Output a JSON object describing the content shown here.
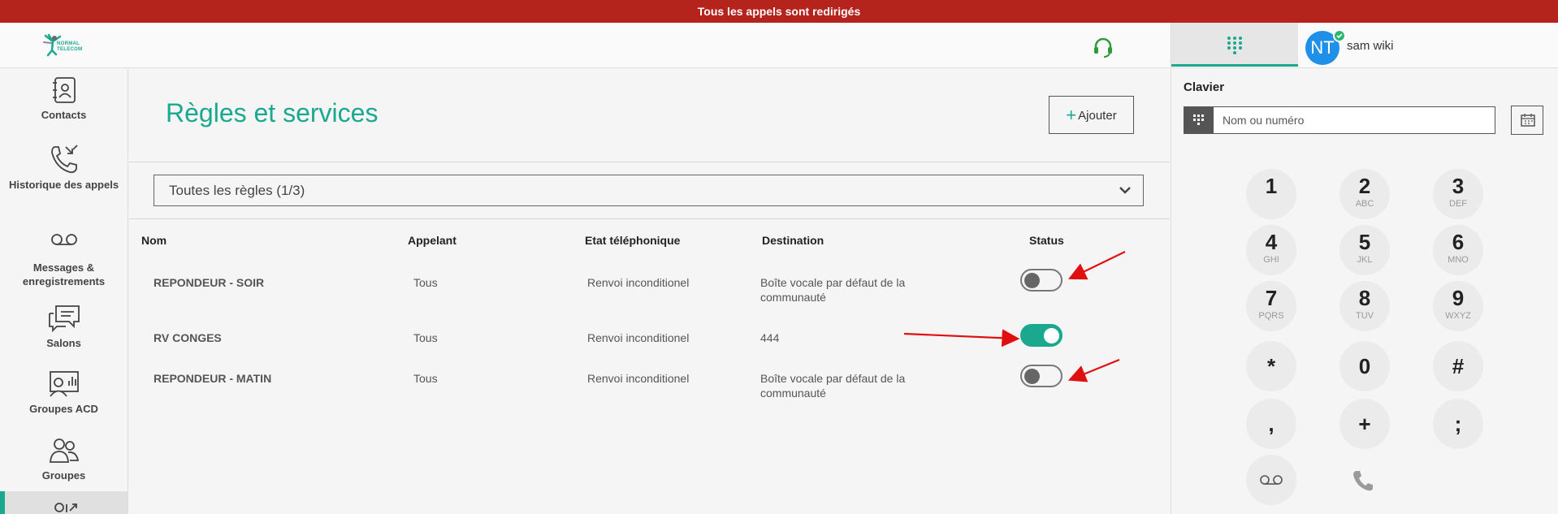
{
  "banner": {
    "text": "Tous les appels sont redirigés"
  },
  "header": {
    "logo_text_line1": "NORMAL",
    "logo_text_line2": "TELECOM",
    "headset_icon": "headset-icon"
  },
  "user": {
    "initials": "NT",
    "name": "sam wiki",
    "status_color": "#2bb673"
  },
  "sidebar": {
    "items": [
      {
        "label": "Contacts",
        "icon": "contacts-book-icon"
      },
      {
        "label": "Historique des appels",
        "icon": "call-history-icon"
      },
      {
        "label": "Messages & enregistrements",
        "icon": "voicemail-icon"
      },
      {
        "label": "Salons",
        "icon": "chat-rooms-icon"
      },
      {
        "label": "Groupes ACD",
        "icon": "acd-groups-icon"
      },
      {
        "label": "Groupes",
        "icon": "groups-icon"
      },
      {
        "label": "",
        "icon": "rules-icon"
      }
    ]
  },
  "main": {
    "title": "Règles et services",
    "add_button": "Ajouter",
    "filter": "Toutes les règles (1/3)",
    "columns": [
      "Nom",
      "Appelant",
      "Etat téléphonique",
      "Destination",
      "Status"
    ],
    "rows": [
      {
        "name": "REPONDEUR - SOIR",
        "caller": "Tous",
        "state": "Renvoi inconditionel",
        "destination": "Boîte vocale par défaut de la communauté",
        "enabled": false
      },
      {
        "name": "RV CONGES",
        "caller": "Tous",
        "state": "Renvoi inconditionel",
        "destination": "444",
        "enabled": true
      },
      {
        "name": "REPONDEUR - MATIN",
        "caller": "Tous",
        "state": "Renvoi inconditionel",
        "destination": "Boîte vocale par défaut de la communauté",
        "enabled": false
      }
    ]
  },
  "keypad": {
    "title": "Clavier",
    "placeholder": "Nom ou numéro",
    "keys": [
      {
        "digit": "1",
        "letters": ""
      },
      {
        "digit": "2",
        "letters": "ABC"
      },
      {
        "digit": "3",
        "letters": "DEF"
      },
      {
        "digit": "4",
        "letters": "GHI"
      },
      {
        "digit": "5",
        "letters": "JKL"
      },
      {
        "digit": "6",
        "letters": "MNO"
      },
      {
        "digit": "7",
        "letters": "PQRS"
      },
      {
        "digit": "8",
        "letters": "TUV"
      },
      {
        "digit": "9",
        "letters": "WXYZ"
      },
      {
        "digit": "*",
        "letters": ""
      },
      {
        "digit": "0",
        "letters": ""
      },
      {
        "digit": "#",
        "letters": ""
      },
      {
        "digit": ",",
        "letters": ""
      },
      {
        "digit": "+",
        "letters": ""
      },
      {
        "digit": ";",
        "letters": ""
      }
    ]
  },
  "colors": {
    "accent": "#1aa88e",
    "banner": "#b5231d",
    "annotation_arrow": "#e01010"
  }
}
